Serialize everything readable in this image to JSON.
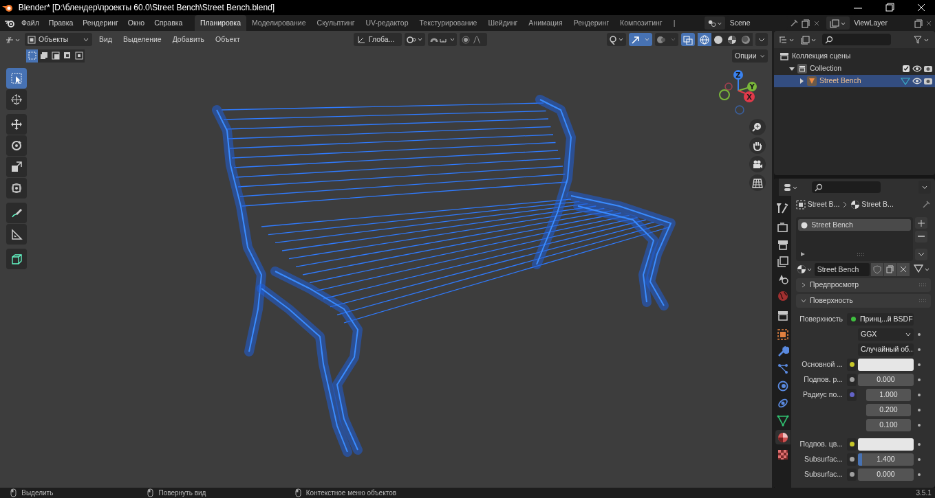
{
  "window": {
    "title": "Blender* [D:\\блендер\\проекты 60.0\\Street Bench\\Street Bench.blend]"
  },
  "menu": [
    "Файл",
    "Правка",
    "Рендеринг",
    "Окно",
    "Справка"
  ],
  "workspaces": [
    {
      "label": "Планировка",
      "selected": true
    },
    {
      "label": "Моделирование",
      "selected": false
    },
    {
      "label": "Скульптинг",
      "selected": false
    },
    {
      "label": "UV-редактор",
      "selected": false
    },
    {
      "label": "Текстурирование",
      "selected": false
    },
    {
      "label": "Шейдинг",
      "selected": false
    },
    {
      "label": "Анимация",
      "selected": false
    },
    {
      "label": "Рендеринг",
      "selected": false
    },
    {
      "label": "Композитинг",
      "selected": false
    },
    {
      "label": "|",
      "selected": false
    }
  ],
  "scene": "Scene",
  "view_layer": "ViewLayer",
  "viewport": {
    "mode": "Объекты",
    "menus": [
      "Вид",
      "Выделение",
      "Добавить",
      "Объект"
    ],
    "orientation": "Глоба...",
    "options": "Опции",
    "gizmos_on": true,
    "xray_on": true,
    "shading": [
      {
        "kind": "wireframe",
        "selected": true
      },
      {
        "kind": "solid",
        "selected": false
      },
      {
        "kind": "material",
        "selected": false
      },
      {
        "kind": "rendered",
        "selected": false
      }
    ],
    "select_modes": [
      {
        "selected": true
      },
      {
        "selected": false
      },
      {
        "selected": false
      },
      {
        "selected": false
      },
      {
        "selected": false
      }
    ],
    "tools": [
      {
        "kind": "select",
        "selected": true
      },
      {
        "kind": "cursor",
        "selected": false
      },
      {
        "kind": "move",
        "selected": false
      },
      {
        "kind": "rotate",
        "selected": false
      },
      {
        "kind": "scale",
        "selected": false
      },
      {
        "kind": "transform",
        "selected": false
      },
      {
        "kind": "annotate",
        "selected": false
      },
      {
        "kind": "measure",
        "selected": false
      },
      {
        "kind": "add-cube",
        "selected": false
      }
    ],
    "axes": [
      "Z",
      "Y",
      "X"
    ]
  },
  "outliner": {
    "items": [
      {
        "label": "Коллекция сцены",
        "kind": "scene-collection",
        "selected": false,
        "children": [
          {
            "label": "Collection",
            "kind": "collection",
            "expanded": true,
            "selected": false,
            "children": [
              {
                "label": "Street Bench",
                "kind": "object",
                "expanded": false,
                "selected": true
              }
            ]
          }
        ]
      }
    ]
  },
  "properties": {
    "tabs": [
      {
        "kind": "tool",
        "selected": false
      },
      {
        "kind": "render",
        "selected": false
      },
      {
        "kind": "output",
        "selected": false
      },
      {
        "kind": "view-layer",
        "selected": false
      },
      {
        "kind": "scene",
        "selected": false
      },
      {
        "kind": "world",
        "selected": false
      },
      {
        "kind": "collection",
        "selected": false
      },
      {
        "kind": "object",
        "selected": false
      },
      {
        "kind": "modifier",
        "selected": false
      },
      {
        "kind": "particles",
        "selected": false
      },
      {
        "kind": "physics",
        "selected": false
      },
      {
        "kind": "constraints",
        "selected": false
      },
      {
        "kind": "data",
        "selected": false
      },
      {
        "kind": "material",
        "selected": true
      },
      {
        "kind": "texture",
        "selected": false
      }
    ],
    "breadcrumb": [
      "Street B...",
      "Street B..."
    ],
    "slots": [
      {
        "label": "Street Bench",
        "selected": true
      }
    ],
    "material": "Street Bench",
    "panels": [
      {
        "label": "Предпросмотр",
        "expanded": false
      },
      {
        "label": "Поверхность",
        "expanded": true
      }
    ],
    "fields": [
      {
        "kind": "link",
        "label": "Поверхность",
        "value": "Принц...й BSDF",
        "color": "#3fbf3f"
      },
      {
        "kind": "dropdown",
        "value": "GGX"
      },
      {
        "kind": "dropdown",
        "value": "Случайный об..."
      },
      {
        "kind": "color",
        "label": "Основной ...",
        "color": "#c7c729"
      },
      {
        "kind": "number",
        "label": "Подпов. р...",
        "value": "0.000",
        "color": "#a1a1a1"
      },
      {
        "kind": "vector",
        "label": "Радиус по...",
        "values": [
          "1.000",
          "0.200",
          "0.100"
        ],
        "color": "#6363c7"
      },
      {
        "kind": "color",
        "label": "Подпов. цв...",
        "color": "#c7c729"
      },
      {
        "kind": "slider",
        "label": "Subsurfac...",
        "value": "1.400",
        "level": 0.07,
        "color": "#a1a1a1"
      },
      {
        "kind": "number",
        "label": "Subsurfac...",
        "value": "0.000",
        "color": "#a1a1a1"
      }
    ]
  },
  "status_bar": {
    "hints": [
      "Выделить",
      "Повернуть вид",
      "Контекстное меню объектов"
    ],
    "version": "3.5.1"
  }
}
